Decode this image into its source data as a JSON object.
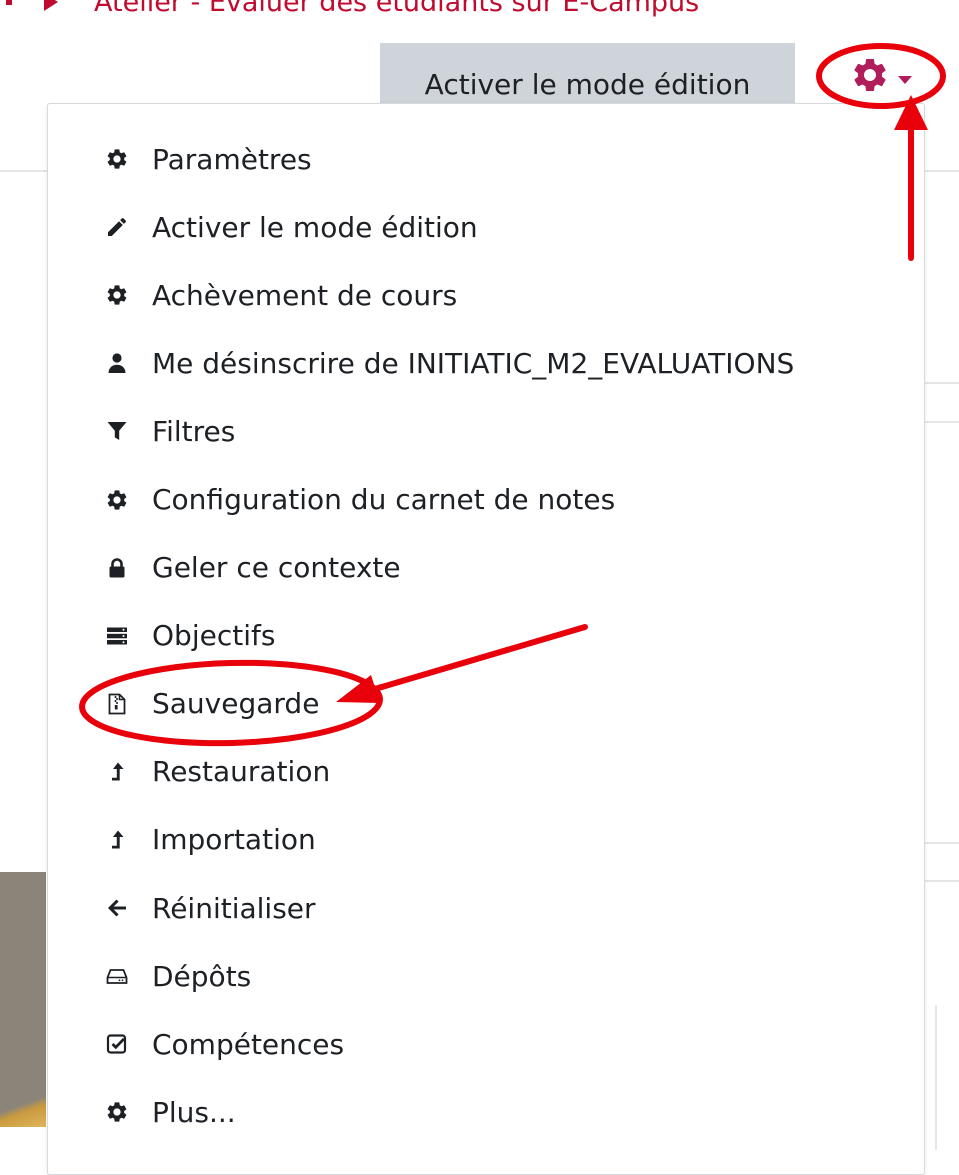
{
  "header": {
    "breadcrumb_course": "Atelier - Evaluer des étudiants sur E-Campus",
    "edit_mode_button": "Activer le mode édition"
  },
  "settings_menu": {
    "items": [
      {
        "label": "Paramètres",
        "icon": "gear-icon"
      },
      {
        "label": "Activer le mode édition",
        "icon": "pencil-icon"
      },
      {
        "label": "Achèvement de cours",
        "icon": "gear-icon"
      },
      {
        "label": "Me désinscrire de INITIATIC_M2_EVALUATIONS",
        "icon": "user-icon"
      },
      {
        "label": "Filtres",
        "icon": "filter-icon"
      },
      {
        "label": "Configuration du carnet de notes",
        "icon": "gear-icon"
      },
      {
        "label": "Geler ce contexte",
        "icon": "lock-icon"
      },
      {
        "label": "Objectifs",
        "icon": "server-icon"
      },
      {
        "label": "Sauvegarde",
        "icon": "file-archive-icon"
      },
      {
        "label": "Restauration",
        "icon": "level-up-icon"
      },
      {
        "label": "Importation",
        "icon": "level-up-icon"
      },
      {
        "label": "Réinitialiser",
        "icon": "arrow-left-icon"
      },
      {
        "label": "Dépôts",
        "icon": "hdd-icon"
      },
      {
        "label": "Compétences",
        "icon": "check-square-icon"
      },
      {
        "label": "Plus...",
        "icon": "gear-icon"
      }
    ]
  },
  "colors": {
    "accent": "#b01d5a",
    "annotation": "#e8000b",
    "menu_text": "#1d2125",
    "icon": "#1d2125"
  }
}
